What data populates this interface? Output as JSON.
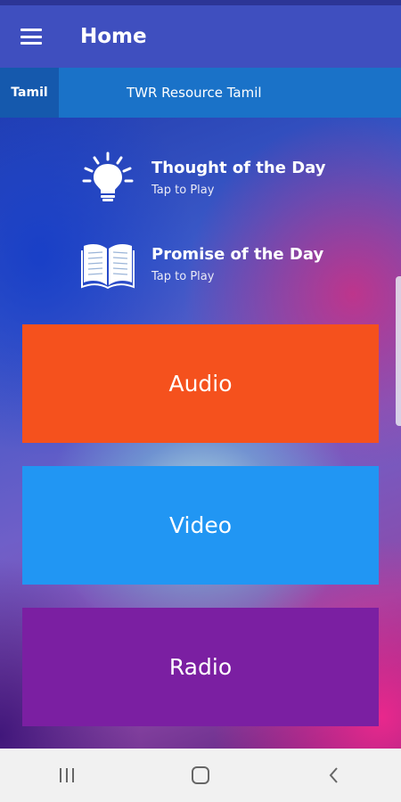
{
  "app_bar": {
    "title": "Home"
  },
  "tabs": {
    "language": "Tamil",
    "resource": "TWR Resource Tamil"
  },
  "features": [
    {
      "title": "Thought of the Day",
      "subtitle": "Tap to Play",
      "icon": "lightbulb-icon"
    },
    {
      "title": "Promise of the Day",
      "subtitle": "Tap to Play",
      "icon": "open-book-icon"
    }
  ],
  "buttons": {
    "audio": "Audio",
    "video": "Video",
    "radio": "Radio"
  },
  "colors": {
    "app_bar": "#3f4fbf",
    "tab_bar": "#1a72c8",
    "audio": "#f5511d",
    "video": "#2196f3",
    "radio": "#7b1fa2"
  },
  "nav_icons": [
    "recent-apps-icon",
    "home-icon",
    "back-icon"
  ]
}
